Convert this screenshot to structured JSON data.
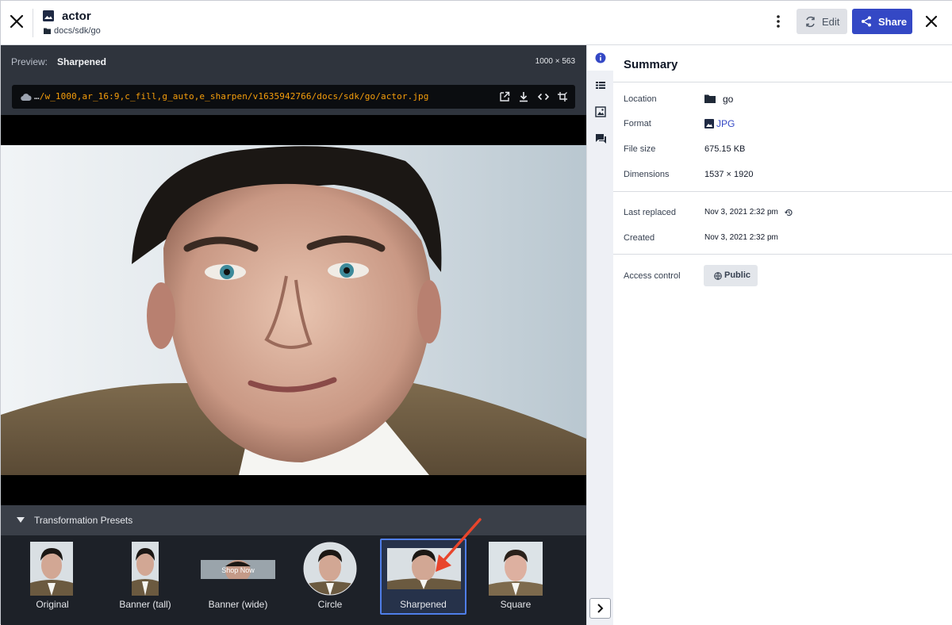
{
  "header": {
    "title": "actor",
    "path": "docs/sdk/go",
    "edit_label": "Edit",
    "share_label": "Share"
  },
  "preview": {
    "label": "Preview:",
    "preset_name": "Sharpened",
    "dimensions": "1000 × 563",
    "url_prefix": "…",
    "url_path": "/w_1000,ar_16:9,c_fill,g_auto,e_sharpen/v1635942766/docs/sdk/go/actor.jpg"
  },
  "presets": {
    "title": "Transformation Presets",
    "items": [
      {
        "label": "Original"
      },
      {
        "label": "Banner (tall)"
      },
      {
        "label": "Banner (wide)",
        "overlay_text": "Shop Now"
      },
      {
        "label": "Circle"
      },
      {
        "label": "Sharpened"
      },
      {
        "label": "Square"
      }
    ],
    "selected": "Sharpened"
  },
  "rail": {
    "icons": [
      "info-icon",
      "list-icon",
      "image-analysis-icon",
      "comments-icon"
    ],
    "active": "info-icon"
  },
  "summary": {
    "title": "Summary",
    "location_label": "Location",
    "location_value": "go",
    "format_label": "Format",
    "format_value": "JPG",
    "filesize_label": "File size",
    "filesize_value": "675.15 KB",
    "dimensions_label": "Dimensions",
    "dimensions_value": "1537 × 1920",
    "last_replaced_label": "Last replaced",
    "last_replaced_value": "Nov 3, 2021 2:32 pm",
    "created_label": "Created",
    "created_value": "Nov 3, 2021 2:32 pm",
    "access_label": "Access control",
    "access_value": "Public"
  },
  "colors": {
    "accent": "#3448c5",
    "url_highlight": "#f59e0b",
    "annotation_arrow": "#e8452c"
  }
}
